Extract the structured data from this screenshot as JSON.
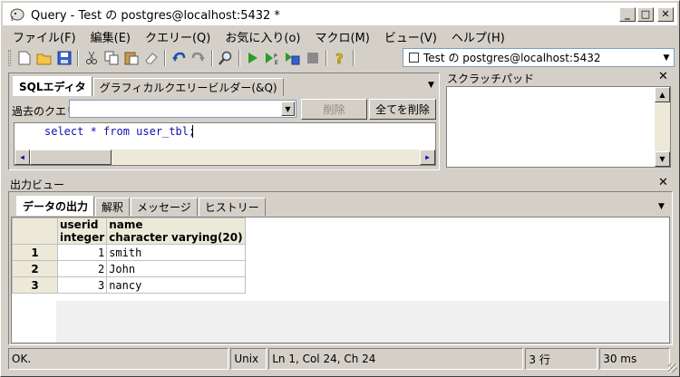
{
  "window": {
    "title": "Query - Test の postgres@localhost:5432 *",
    "minimize": "_",
    "maximize": "□",
    "close": "✕"
  },
  "menu": [
    "ファイル(F)",
    "編集(E)",
    "クエリー(Q)",
    "お気に入り(o)",
    "マクロ(M)",
    "ビュー(V)",
    "ヘルプ(H)"
  ],
  "toolbar": {
    "icons": [
      "new-file-icon",
      "open-folder-icon",
      "save-icon",
      "cut-icon",
      "copy-icon",
      "paste-icon",
      "clear-icon",
      "undo-icon",
      "redo-icon",
      "find-icon",
      "execute-icon",
      "explain-icon",
      "execute-to-file-icon",
      "stop-icon",
      "help-icon"
    ],
    "connection": "Test の postgres@localhost:5432"
  },
  "sql_editor": {
    "tabs": [
      "SQLエディタ",
      "グラフィカルクエリービルダー(&Q)"
    ],
    "history_label": "過去のクエリ",
    "history_value": "",
    "delete_button": "削除",
    "delete_all_button": "全てを削除",
    "query_text": "select * from user_tbl;"
  },
  "scratch_pad": {
    "title": "スクラッチパッド",
    "text": ""
  },
  "output": {
    "title": "出力ビュー",
    "tabs": [
      "データの出力",
      "解釈",
      "メッセージ",
      "ヒストリー"
    ],
    "columns": [
      {
        "name": "userid",
        "type": "integer"
      },
      {
        "name": "name",
        "type": "character varying(20)"
      }
    ],
    "rows": [
      {
        "index": "1",
        "userid": "1",
        "name": "smith"
      },
      {
        "index": "2",
        "userid": "2",
        "name": "John"
      },
      {
        "index": "3",
        "userid": "3",
        "name": "nancy"
      }
    ]
  },
  "status": {
    "message": "OK.",
    "line_ending": "Unix",
    "position": "Ln 1, Col 24, Ch 24",
    "row_count": "3 行",
    "elapsed": "30 ms"
  }
}
